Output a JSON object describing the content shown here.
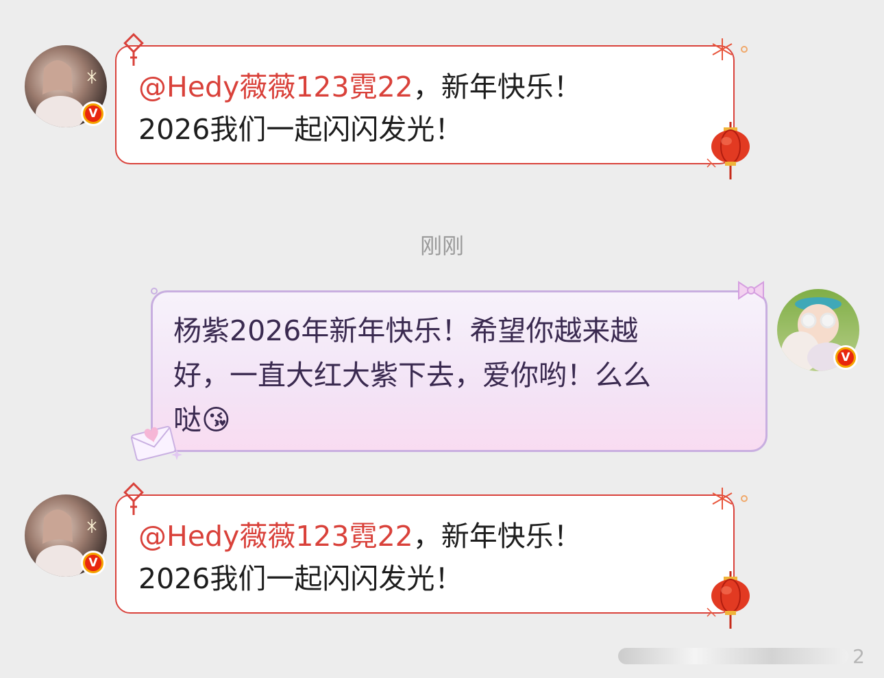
{
  "messages": [
    {
      "mention": "@Hedy薇薇123霓22",
      "line1_rest": "，新年快乐！",
      "line2": "2026我们一起闪闪发光！",
      "badge": "V"
    },
    {
      "mention": "@Hedy薇薇123霓22",
      "line1_rest": "，新年快乐！",
      "line2": "2026我们一起闪闪发光！",
      "badge": "V"
    }
  ],
  "timestamp": "刚刚",
  "reply": {
    "line1": "杨紫2026年新年快乐！希望你越来越",
    "line2": "好，一直大红大紫下去，爱你哟！么么",
    "line3": "哒😘",
    "badge": "V"
  },
  "pager": {
    "count": "2"
  },
  "colors": {
    "accent_red": "#d9413a",
    "purple_border": "#c8aee0",
    "badge_gold": "#f5a300"
  }
}
